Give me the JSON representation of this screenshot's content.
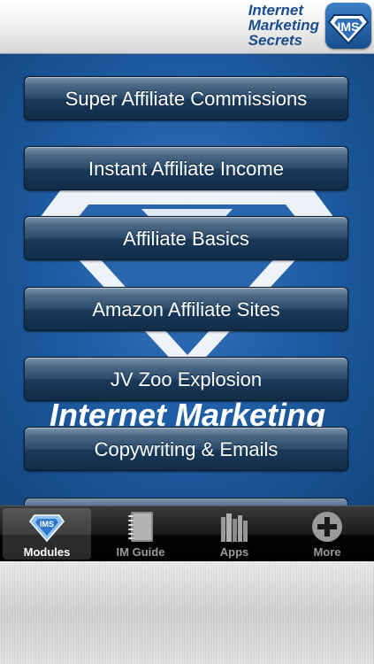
{
  "header": {
    "title": "Internet\nMarketing\nSecrets",
    "logo_icon": "diamond-shield-icon"
  },
  "background": {
    "watermark_text": "Internet Marketing",
    "accent": "#1f5ea6"
  },
  "menu": {
    "items": [
      {
        "label": "Super Affiliate Commissions"
      },
      {
        "label": "Instant Affiliate Income"
      },
      {
        "label": "Affiliate Basics"
      },
      {
        "label": "Amazon Affiliate Sites"
      },
      {
        "label": "JV Zoo Explosion"
      },
      {
        "label": "Copywriting & Emails"
      }
    ]
  },
  "tabbar": {
    "tabs": [
      {
        "label": "Modules",
        "icon": "diamond-icon",
        "active": true
      },
      {
        "label": "IM Guide",
        "icon": "notebook-icon",
        "active": false
      },
      {
        "label": "Apps",
        "icon": "books-icon",
        "active": false
      },
      {
        "label": "More",
        "icon": "plus-circle-icon",
        "active": false
      }
    ]
  }
}
